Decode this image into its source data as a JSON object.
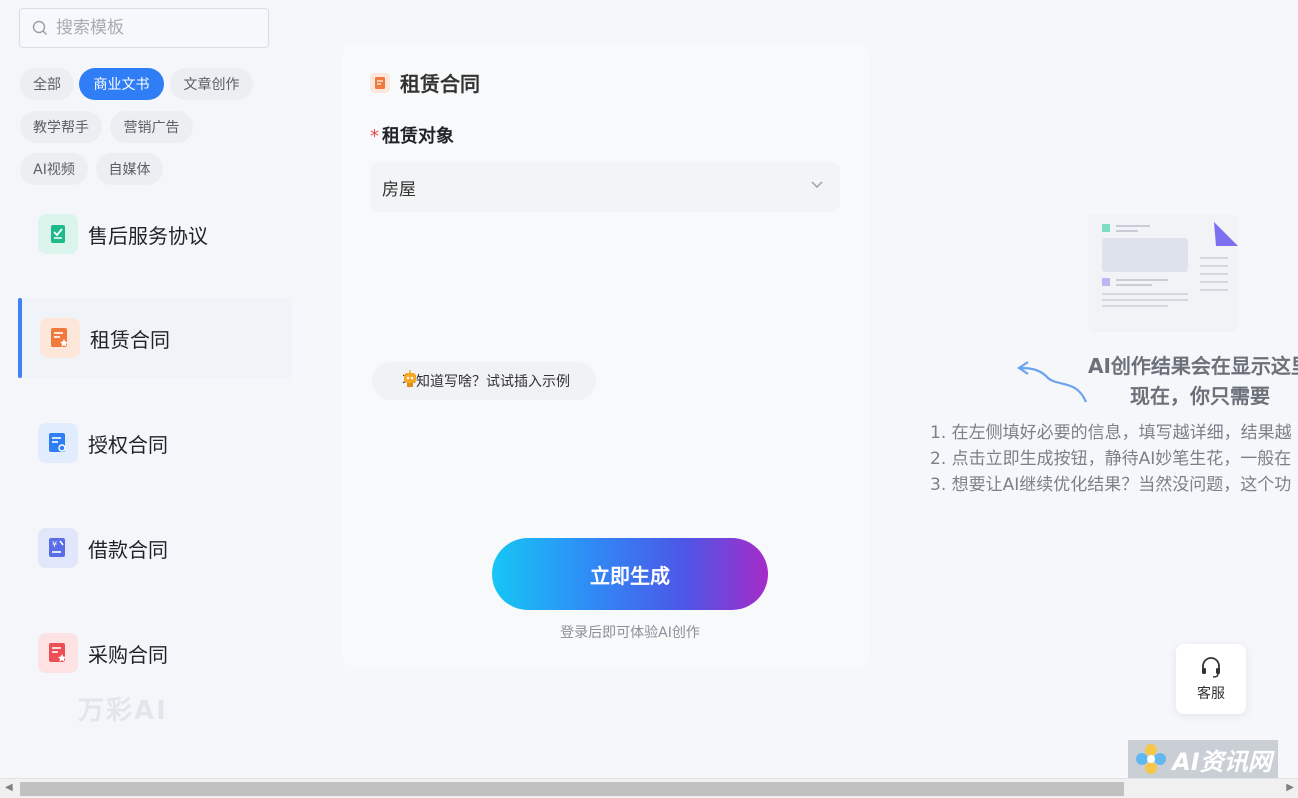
{
  "search": {
    "placeholder": "搜索模板"
  },
  "categories": [
    {
      "label": "全部"
    },
    {
      "label": "商业文书"
    },
    {
      "label": "文章创作"
    },
    {
      "label": "教学帮手"
    },
    {
      "label": "营销广告"
    },
    {
      "label": "AI视频"
    },
    {
      "label": "自媒体"
    }
  ],
  "active_category": "商业文书",
  "templates": [
    {
      "label": "售后服务协议",
      "icon": "document-check-icon",
      "color": "#1fb98a"
    },
    {
      "label": "租赁合同",
      "icon": "document-star-icon",
      "color": "#f07a3e"
    },
    {
      "label": "授权合同",
      "icon": "document-gear-icon",
      "color": "#2f7ef5"
    },
    {
      "label": "借款合同",
      "icon": "document-yen-icon",
      "color": "#5b6ee8"
    },
    {
      "label": "采购合同",
      "icon": "document-star-icon",
      "color": "#ec4f56"
    }
  ],
  "brand": {
    "text": "万彩AI"
  },
  "form": {
    "title": "租赁合同",
    "field_label": "租赁对象",
    "required_mark": "*",
    "field_value": "房屋",
    "hint": "不知道写啥？试试插入示例",
    "generate_label": "立即生成",
    "login_tip": "登录后即可体验AI创作"
  },
  "result": {
    "title": "AI创作结果会在显示这里",
    "subtitle": "现在，你只需要",
    "steps": [
      "1. 在左侧填好必要的信息，填写越详细，结果越",
      "2. 点击立即生成按钮，静待AI妙笔生花，一般在",
      "3. 想要让AI继续优化结果？当然没问题，这个功"
    ]
  },
  "service": {
    "label": "客服"
  },
  "watermark": {
    "text": "AI资讯网"
  },
  "colors": {
    "accent": "#2f7ef5",
    "gradient_start": "#16c6f5",
    "gradient_end": "#a62bc8"
  }
}
